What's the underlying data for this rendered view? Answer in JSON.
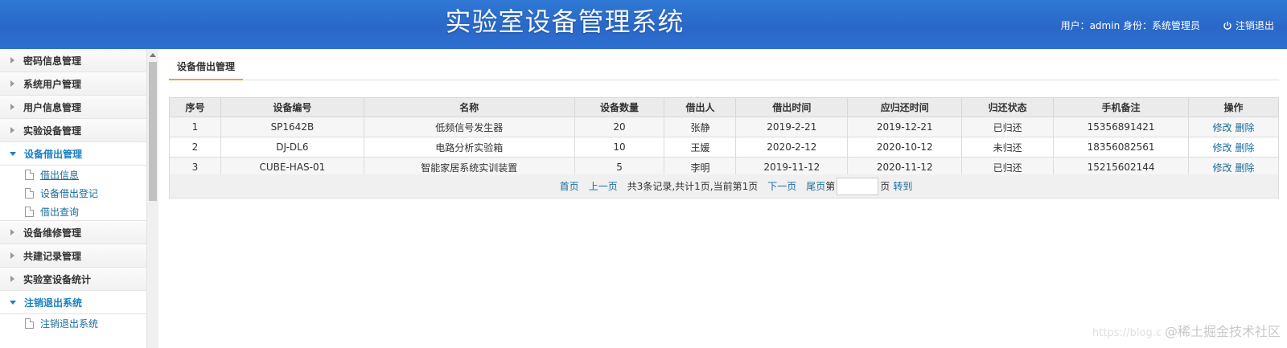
{
  "header": {
    "title": "实验室设备管理系统",
    "user_info": "用户：admin 身份：系统管理员",
    "logout_label": "注销退出"
  },
  "sidebar": {
    "items": [
      {
        "label": "密码信息管理",
        "open": false
      },
      {
        "label": "系统用户管理",
        "open": false
      },
      {
        "label": "用户信息管理",
        "open": false
      },
      {
        "label": "实验设备管理",
        "open": false
      },
      {
        "label": "设备借出管理",
        "open": true,
        "children": [
          "借出信息",
          "设备借出登记",
          "借出查询"
        ]
      },
      {
        "label": "设备维修管理",
        "open": false
      },
      {
        "label": "共建记录管理",
        "open": false
      },
      {
        "label": "实验室设备统计",
        "open": false
      },
      {
        "label": "注销退出系统",
        "open": true,
        "children": [
          "注销退出系统"
        ]
      }
    ]
  },
  "main": {
    "tab_label": "设备借出管理",
    "table": {
      "columns": [
        "序号",
        "设备编号",
        "名称",
        "设备数量",
        "借出人",
        "借出时间",
        "应归还时间",
        "归还状态",
        "手机备注",
        "操作"
      ],
      "rows": [
        [
          "1",
          "SP1642B",
          "低频信号发生器",
          "20",
          "张静",
          "2019-2-21",
          "2019-12-21",
          "已归还",
          "15356891421"
        ],
        [
          "2",
          "DJ-DL6",
          "电路分析实验箱",
          "10",
          "王媛",
          "2020-2-12",
          "2020-10-12",
          "未归还",
          "18356082561"
        ],
        [
          "3",
          "CUBE-HAS-01",
          "智能家居系统实训装置",
          "5",
          "李明",
          "2019-11-12",
          "2020-11-12",
          "已归还",
          "15215602144"
        ]
      ],
      "edit_label": "修改",
      "delete_label": "删除"
    },
    "pager": {
      "first": "首页",
      "prev": "上一页",
      "info": "共3条记录,共计1页,当前第1页",
      "next": "下一页",
      "last": "尾页",
      "page_prefix": "第",
      "page_suffix": "页",
      "go": "转到"
    }
  },
  "watermark": {
    "url": "https://blog.c",
    "text": "@稀土掘金技术社区"
  },
  "colors": {
    "header_blue": "#2d6fd0",
    "link_blue": "#1a6d9c",
    "tab_underline": "#e7a23c"
  }
}
